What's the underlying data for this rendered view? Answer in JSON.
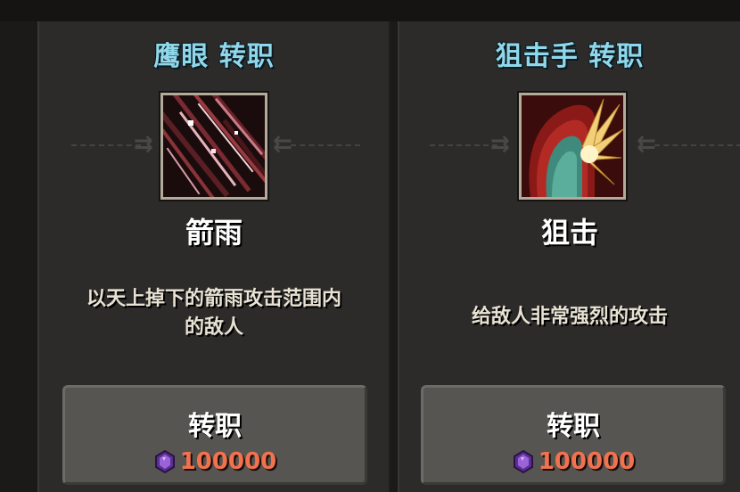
{
  "cards": [
    {
      "title": "鹰眼 转职",
      "skill": {
        "icon": "arrow-rain-icon",
        "name": "箭雨",
        "description_lines": [
          "以天上掉下的箭雨攻击范围内",
          "的敌人"
        ]
      },
      "button": {
        "label": "转职",
        "cost_icon": "purple-gem-icon",
        "cost": "100000"
      }
    },
    {
      "title": "狙击手 转职",
      "skill": {
        "icon": "snipe-icon",
        "name": "狙击",
        "description_lines": [
          "给敌人非常强烈的攻击"
        ]
      },
      "button": {
        "label": "转职",
        "cost_icon": "purple-gem-icon",
        "cost": "100000"
      }
    }
  ],
  "colors": {
    "title": "#8fd8ec",
    "cost": "#f0724e",
    "gem": "#8a55c9",
    "button": "#575552",
    "panel": "#2c2b29"
  }
}
